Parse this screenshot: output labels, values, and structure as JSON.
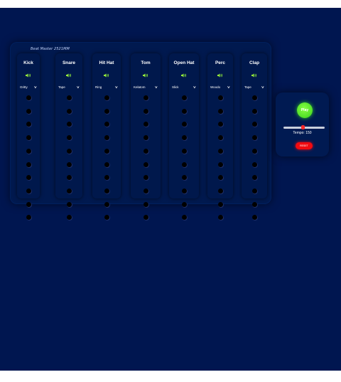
{
  "machine": {
    "title": "Beat Master 2521MM"
  },
  "tracks": [
    {
      "name": "Kick",
      "sample": "Gritty"
    },
    {
      "name": "Snare",
      "sample": "Tape"
    },
    {
      "name": "Hit Hat",
      "sample": "Ring"
    },
    {
      "name": "Tom",
      "sample": "Kelatom"
    },
    {
      "name": "Open Hat",
      "sample": "Slick"
    },
    {
      "name": "Perc",
      "sample": "Woodo"
    },
    {
      "name": "Clap",
      "sample": "Tape"
    }
  ],
  "steps_per_track": 10,
  "controls": {
    "play_label": "Play",
    "tempo_label": "Tempo: 150",
    "tempo_value": 150,
    "tempo_slider_fraction": 0.47,
    "reset_label": "RESET"
  },
  "icons": {
    "speaker": "speaker-icon",
    "dropdown": "chevron-down-icon"
  },
  "colors": {
    "background": "#001650",
    "play": "#44dd22",
    "speaker": "#9cff3a",
    "reset": "#f20a10",
    "slider_thumb": "#ff2a2a"
  }
}
